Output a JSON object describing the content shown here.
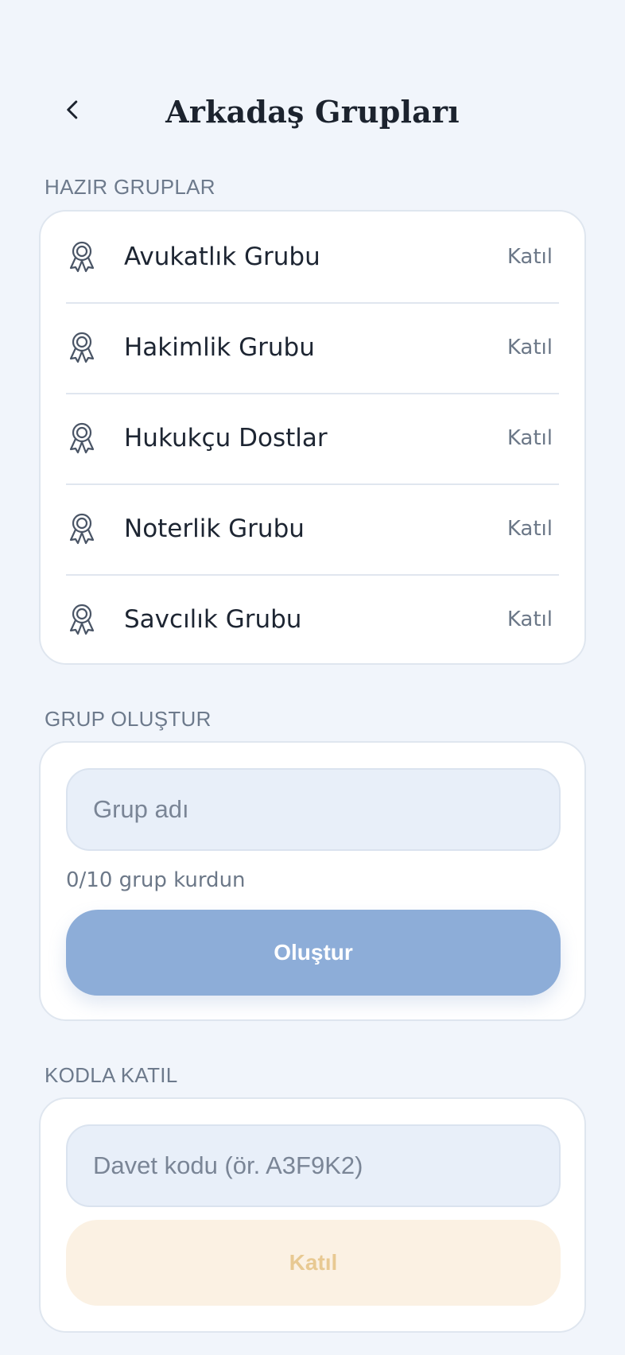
{
  "header": {
    "title": "Arkadaş Grupları",
    "back_icon": "chevron-left-icon"
  },
  "ready_groups": {
    "section_label": "HAZIR GRUPLAR",
    "icon": "award-ribbon-icon",
    "items": [
      {
        "name": "Avukatlık Grubu",
        "action": "Katıl"
      },
      {
        "name": "Hakimlik Grubu",
        "action": "Katıl"
      },
      {
        "name": "Hukukçu Dostlar",
        "action": "Katıl"
      },
      {
        "name": "Noterlik Grubu",
        "action": "Katıl"
      },
      {
        "name": "Savcılık Grubu",
        "action": "Katıl"
      }
    ]
  },
  "create_group": {
    "section_label": "GRUP OLUŞTUR",
    "input_value": "",
    "input_placeholder": "Grup adı",
    "counter_text": "0/10 grup kurdun",
    "button_label": "Oluştur",
    "button_color": "#8dadd8"
  },
  "join_by_code": {
    "section_label": "KODLA KATIL",
    "input_value": "",
    "input_placeholder": "Davet kodu (ör. A3F9K2)",
    "button_label": "Katıl",
    "button_color": "#fbf1e3",
    "button_text_color": "#e8c992"
  },
  "colors": {
    "background": "#f1f5fb",
    "card": "#ffffff",
    "muted_text": "#6c7888"
  }
}
